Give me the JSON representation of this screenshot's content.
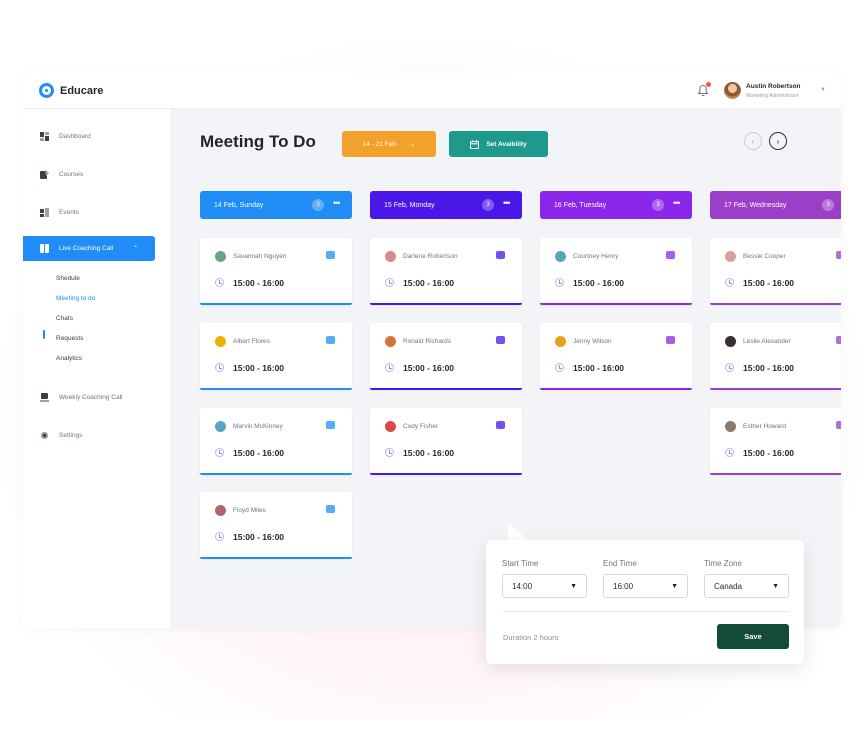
{
  "app": {
    "name": "Educare"
  },
  "user": {
    "name": "Austin Robertson",
    "role": "Marketing Administrator"
  },
  "sidebar": {
    "items": [
      {
        "label": "Dashboard"
      },
      {
        "label": "Courses"
      },
      {
        "label": "Events"
      },
      {
        "label": "Live Coaching Call"
      },
      {
        "label": "Weekly Coaching Call"
      },
      {
        "label": "Settings"
      }
    ],
    "sub_items": [
      {
        "label": "Shedule"
      },
      {
        "label": "Meeting to do"
      },
      {
        "label": "Chats"
      },
      {
        "label": "Requests"
      },
      {
        "label": "Analytics"
      }
    ]
  },
  "main": {
    "title": "Meeting To Do",
    "date_range": "14 - 21 Feb",
    "availability_label": "Set Avaibility"
  },
  "columns": [
    {
      "title": "14 Feb, Sunday",
      "count": "3",
      "color": "#1f8df5",
      "meetings": [
        {
          "name": "Savannah Nguyen",
          "time": "15:00 - 16:00",
          "avatar": "#6aa37f"
        },
        {
          "name": "Albert Flores",
          "time": "15:00 - 16:00",
          "avatar": "#e8b400"
        },
        {
          "name": "Marvin McKinney",
          "time": "15:00 - 16:00",
          "avatar": "#5aa4c2"
        },
        {
          "name": "Floyd Miles",
          "time": "15:00 - 16:00",
          "avatar": "#b0646d"
        }
      ]
    },
    {
      "title": "15 Feb, Monday",
      "count": "3",
      "color": "#4a17e8",
      "meetings": [
        {
          "name": "Darlene Robertson",
          "time": "15:00 - 16:00",
          "avatar": "#d98a8a"
        },
        {
          "name": "Ronald Richards",
          "time": "15:00 - 16:00",
          "avatar": "#d0763a"
        },
        {
          "name": "Cody Fisher",
          "time": "15:00 - 16:00",
          "avatar": "#e04848"
        }
      ]
    },
    {
      "title": "16 Feb, Tuesday",
      "count": "3",
      "color": "#8a27ea",
      "meetings": [
        {
          "name": "Courtney Henry",
          "time": "15:00 - 16:00",
          "avatar": "#5aa6b5"
        },
        {
          "name": "Jenny Wilson",
          "time": "15:00 - 16:00",
          "avatar": "#e8a21a"
        }
      ]
    },
    {
      "title": "17 Feb, Wednesday",
      "count": "3",
      "color": "#9b3fc8",
      "meetings": [
        {
          "name": "Bessie Cooper",
          "time": "15:00 - 16:00",
          "avatar": "#d9a0a0"
        },
        {
          "name": "Leslie Alexander",
          "time": "15:00 - 16:00",
          "avatar": "#3a3030"
        },
        {
          "name": "Esther Howard",
          "time": "15:00 - 16:00",
          "avatar": "#8a7a6a"
        }
      ]
    }
  ],
  "popup": {
    "start_label": "Start Time",
    "start_value": "14:00",
    "end_label": "End Time",
    "end_value": "16:00",
    "tz_label": "Time Zone",
    "tz_value": "Canada",
    "duration": "Duration 2 hours",
    "save_label": "Save"
  }
}
